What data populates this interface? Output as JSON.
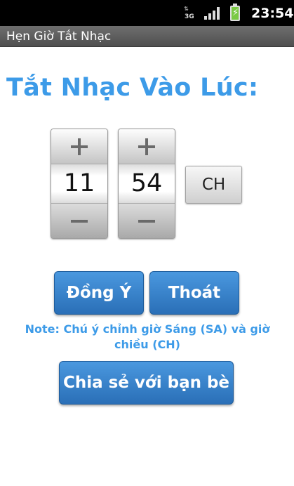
{
  "status_bar": {
    "network_label": "3G",
    "network_arrows": "⇅",
    "signal_bars": 4,
    "battery_charging": true,
    "time": "23:54"
  },
  "app": {
    "title": "Hẹn Giờ Tắt Nhạc"
  },
  "main": {
    "heading": "Tắt Nhạc Vào Lúc:",
    "time_picker": {
      "hour": "11",
      "minute": "54",
      "am_pm": "CH"
    },
    "buttons": {
      "ok": "Đồng Ý",
      "exit": "Thoát",
      "share": "Chia sẻ với bạn bè"
    },
    "note": "Note: Chú ý chỉnh giờ Sáng (SA) và giờ chiều (CH)"
  },
  "colors": {
    "accent": "#3d9be8",
    "button": "#3a85cf",
    "titlebar": "#5f5f5f"
  }
}
